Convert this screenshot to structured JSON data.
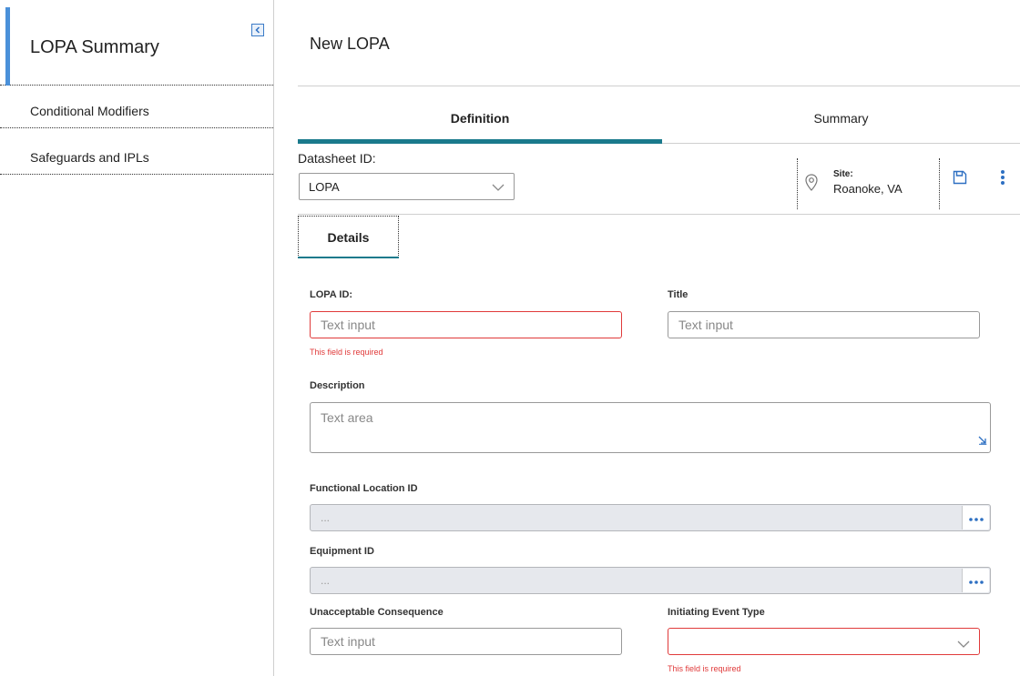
{
  "sidebar": {
    "title": "LOPA Summary",
    "items": [
      {
        "label": "Conditional Modifiers"
      },
      {
        "label": "Safeguards and IPLs"
      }
    ]
  },
  "main": {
    "page_title": "New LOPA",
    "tabs": [
      {
        "label": "Definition",
        "active": true
      },
      {
        "label": "Summary",
        "active": false
      }
    ],
    "datasheet": {
      "label": "Datasheet ID:",
      "value": "LOPA"
    },
    "site": {
      "label": "Site:",
      "value": "Roanoke, VA"
    },
    "subtab": {
      "label": "Details"
    },
    "form": {
      "lopa_id": {
        "label": "LOPA ID:",
        "placeholder": "Text input",
        "error": "This field is required"
      },
      "title": {
        "label": "Title",
        "placeholder": "Text input"
      },
      "description": {
        "label": "Description",
        "placeholder": "Text area"
      },
      "functional_location": {
        "label": "Functional Location ID",
        "value": "..."
      },
      "equipment": {
        "label": "Equipment ID",
        "value": "..."
      },
      "unacceptable_consequence": {
        "label": "Unacceptable Consequence",
        "placeholder": "Text input"
      },
      "initiating_event_type": {
        "label": "Initiating Event Type",
        "value": "",
        "error": "This field is required"
      }
    }
  },
  "colors": {
    "accent": "#4a90d9",
    "tab_underline": "#1a7a8c",
    "error": "#e03a3a",
    "icon_blue": "#2d6fc2"
  },
  "icons": [
    "collapse-left-icon",
    "chevron-down-icon",
    "location-pin-icon",
    "save-icon",
    "more-vertical-icon",
    "resize-icon",
    "ellipsis-icon"
  ]
}
